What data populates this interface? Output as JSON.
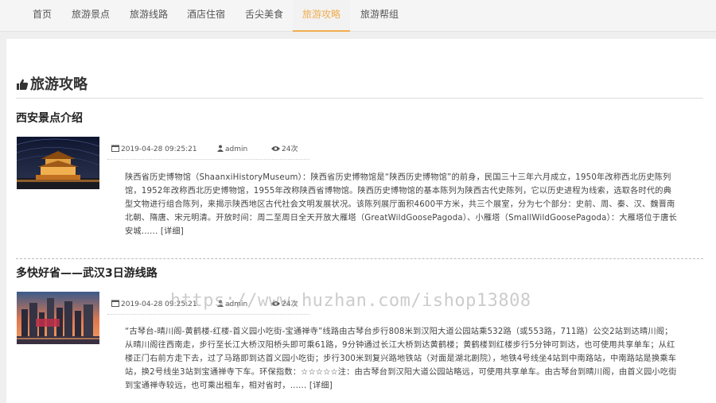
{
  "nav": {
    "items": [
      {
        "label": "首页"
      },
      {
        "label": "旅游景点"
      },
      {
        "label": "旅游线路"
      },
      {
        "label": "酒店住宿"
      },
      {
        "label": "舌尖美食"
      },
      {
        "label": "旅游攻略"
      },
      {
        "label": "旅游帮组"
      }
    ],
    "active_index": 5
  },
  "page": {
    "section_title": "旅游攻略",
    "accent_color": "#f0ad4e"
  },
  "articles": [
    {
      "title": "西安景点介绍",
      "date": "2019-04-28 09:25:21",
      "author": "admin",
      "views": "24次",
      "summary": "陕西省历史博物馆（ShaanxiHistoryMuseum）：陕西省历史博物馆是“陕西历史博物馆”的前身，民国三十三年六月成立，1950年改称西北历史陈列馆，1952年改称西北历史博物馆，1955年改称陕西省博物馆。陕西历史博物馆的基本陈列为陕西古代史陈列，它以历史进程为线索，选取各时代的典型文物进行组合陈列，来揭示陕西地区古代社会文明发展状况。该陈列展厅面积4600平方米，共三个展室，分为七个部分：史前、周、秦、汉、魏晋南北朝、隋唐、宋元明清。开放时间：周二至周日全天开放大雁塔（GreatWildGoosePagoda）、小雁塔（SmallWildGoosePagoda）：大雁塔位于唐长安城......",
      "more": "[详细]"
    },
    {
      "title": "多快好省——武汉3日游线路",
      "date": "2019-04-28 09:25:21",
      "author": "admin",
      "views": "24次",
      "summary": "“古琴台-晴川阁-黄鹤楼-红楼-首义园小吃街-宝通禅寺”线路由古琴台步行808米到汉阳大道公园站乘532路（或553路，711路）公交2站到达晴川阁；从晴川阁往西南走，步行至长江大桥汉阳桥头即可乘61路，9分钟通过长江大桥到达黄鹤楼；黄鹤楼到红楼步行5分钟可到达，也可使用共享单车；从红楼正门右前方走下去，过了马路即到达首义园小吃街；步行300米到复兴路地铁站（对面是湖北剧院），地铁4号线坐4站到中南路站，中南路站是换乘车站，换2号线坐3站到宝通禅寺下车。环保指数：☆☆☆☆☆注：由古琴台到汉阳大道公园站略远，可使用共享单车。由古琴台到晴川阁，由首义园小吃街到宝通禅寺较远，也可乘出租车，相对省时，......",
      "more": "[详细]"
    }
  ],
  "watermark": "https://www.huzhan.com/ishop13808"
}
